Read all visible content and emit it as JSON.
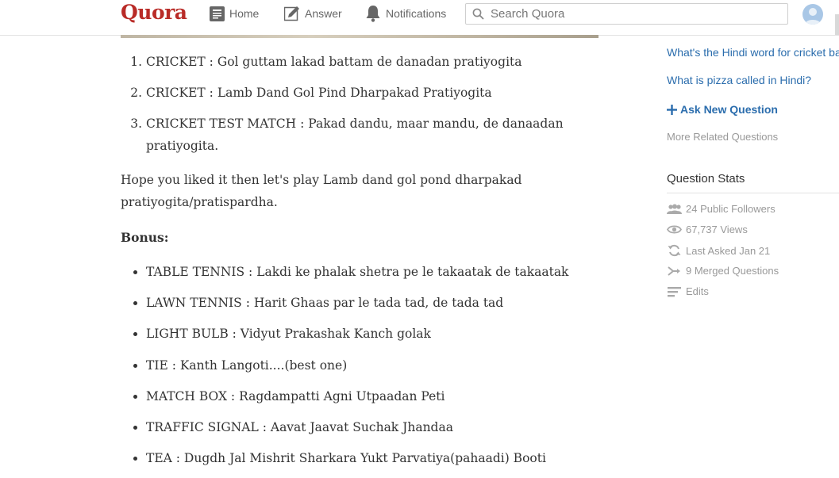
{
  "header": {
    "logo": "Quora",
    "nav": {
      "home": "Home",
      "answer": "Answer",
      "notifications": "Notifications"
    },
    "search_placeholder": "Search Quora"
  },
  "answer": {
    "numbered_items": [
      "CRICKET : Gol guttam lakad battam de danadan pratiyogita",
      "CRICKET : Lamb Dand Gol Pind Dharpakad Pratiyogita",
      "CRICKET TEST MATCH : Pakad dandu, maar mandu, de danaadan pratiyogita."
    ],
    "paragraph": "Hope you liked it then let's play Lamb dand gol pond dharpakad pratiyogita/pratispardha.",
    "bonus_heading": "Bonus:",
    "bonus_items": [
      "TABLE TENNIS : Lakdi ke phalak shetra pe le takaatak de takaatak",
      "LAWN TENNIS : Harit Ghaas par le tada tad, de tada tad",
      "LIGHT BULB : Vidyut Prakashak Kanch golak",
      "TIE : Kanth Langoti....(best one)",
      "MATCH BOX : Ragdampatti Agni Utpaadan Peti",
      "TRAFFIC SIGNAL : Aavat Jaavat Suchak Jhandaa",
      "TEA : Dugdh Jal Mishrit Sharkara Yukt Parvatiya(pahaadi) Booti"
    ]
  },
  "sidebar": {
    "related": [
      "What's the Hindi word for cricket ba",
      "What is pizza called in Hindi?"
    ],
    "ask_new_question": "Ask New Question",
    "more_related": "More Related Questions",
    "stats_title": "Question Stats",
    "stats": {
      "followers": "24 Public Followers",
      "views": "67,737 Views",
      "last_asked": "Last Asked Jan 21",
      "merged": "9 Merged Questions",
      "edits": "Edits"
    }
  },
  "colors": {
    "brand": "#b92b27",
    "link": "#2b6dad",
    "muted": "#999999"
  }
}
